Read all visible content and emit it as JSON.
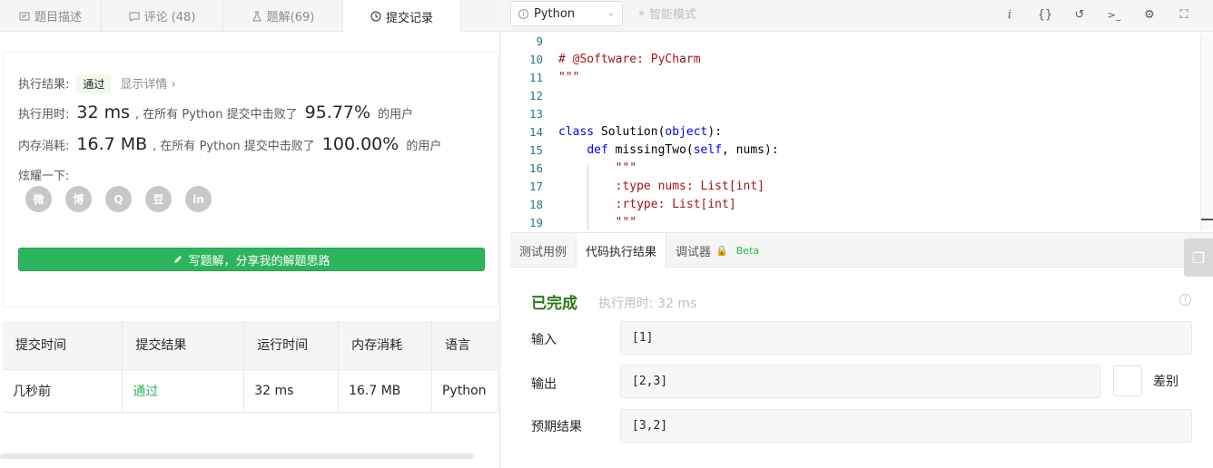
{
  "left_tabs": [
    {
      "label": "题目描述",
      "icon": "description-icon",
      "active": false
    },
    {
      "label": "评论 (48)",
      "icon": "comment-icon",
      "active": false
    },
    {
      "label": "题解(69)",
      "icon": "flask-icon",
      "active": false
    },
    {
      "label": "提交记录",
      "icon": "clock-icon",
      "active": true
    }
  ],
  "result": {
    "label": "执行结果:",
    "status": "通过",
    "detail_link": "显示详情 ›",
    "runtime_label": "执行用时:",
    "runtime_value": "32 ms",
    "runtime_mid": ", 在所有 Python 提交中击败了",
    "runtime_pct": "95.77%",
    "runtime_suffix": "的用户",
    "memory_label": "内存消耗:",
    "memory_value": "16.7 MB",
    "memory_mid": ", 在所有 Python 提交中击败了",
    "memory_pct": "100.00%",
    "memory_suffix": "的用户",
    "share_label": "炫耀一下:",
    "share_icons": [
      "wechat-icon",
      "weibo-icon",
      "qq-icon",
      "douban-icon",
      "linkedin-icon"
    ],
    "share_glyphs": [
      "微",
      "博",
      "Q",
      "豆",
      "in"
    ],
    "write_button": "写题解，分享我的解题思路"
  },
  "submissions": {
    "headers": [
      "提交时间",
      "提交结果",
      "运行时间",
      "内存消耗",
      "语言"
    ],
    "rows": [
      [
        "几秒前",
        "通过",
        "32 ms",
        "16.7 MB",
        "Python"
      ]
    ]
  },
  "editor_toolbar": {
    "language": "Python",
    "smart_mode": "智能模式",
    "tools": [
      "info-icon",
      "braces-icon",
      "reset-icon",
      "console-icon",
      "settings-icon",
      "fullscreen-icon"
    ],
    "tool_glyphs": [
      "i",
      "{}",
      "↺",
      ">_",
      "⚙",
      "⛶"
    ]
  },
  "code_lines": [
    {
      "n": "9",
      "text": ""
    },
    {
      "n": "10",
      "text": "# @Software: PyCharm"
    },
    {
      "n": "11",
      "text": "\"\"\""
    },
    {
      "n": "12",
      "text": ""
    },
    {
      "n": "13",
      "text": ""
    },
    {
      "n": "14",
      "text": "class Solution(object):"
    },
    {
      "n": "15",
      "text": "    def missingTwo(self, nums):"
    },
    {
      "n": "16",
      "text": "        \"\"\""
    },
    {
      "n": "17",
      "text": "        :type nums: List[int]"
    },
    {
      "n": "18",
      "text": "        :rtype: List[int]"
    },
    {
      "n": "19",
      "text": "        \"\"\""
    }
  ],
  "bottom_tabs": [
    {
      "label": "测试用例",
      "active": false
    },
    {
      "label": "代码执行结果",
      "active": true
    },
    {
      "label": "调试器",
      "active": false,
      "badge": "Beta"
    }
  ],
  "exec_result": {
    "status": "已完成",
    "time": "执行用时: 32 ms",
    "input_label": "输入",
    "input_value": "[1]",
    "output_label": "输出",
    "output_value": "[2,3]",
    "expected_label": "预期结果",
    "expected_value": "[3,2]",
    "diff_label": "差别"
  }
}
